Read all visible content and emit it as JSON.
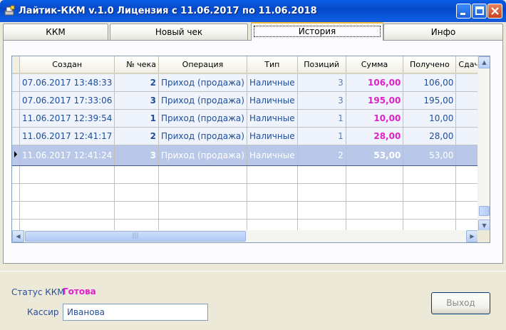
{
  "window": {
    "title": "Лайтик-ККМ v.1.0  Лицензия с 11.06.2017 по 11.06.2018"
  },
  "tabs": [
    {
      "label": "ККМ"
    },
    {
      "label": "Новый чек"
    },
    {
      "label": "История"
    },
    {
      "label": "Инфо"
    }
  ],
  "active_tab": "История",
  "table": {
    "columns": [
      "Создан",
      "№ чека",
      "Операция",
      "Тип",
      "Позиций",
      "Сумма",
      "Получено",
      "Сдача"
    ],
    "rows": [
      {
        "created": "07.06.2017 13:48:33",
        "number": "2",
        "operation": "Приход (продажа)",
        "type": "Наличные",
        "positions": "3",
        "sum": "106,00",
        "received": "106,00",
        "change": ""
      },
      {
        "created": "07.06.2017 17:33:06",
        "number": "3",
        "operation": "Приход (продажа)",
        "type": "Наличные",
        "positions": "3",
        "sum": "195,00",
        "received": "195,00",
        "change": ""
      },
      {
        "created": "11.06.2017 12:39:54",
        "number": "1",
        "operation": "Приход (продажа)",
        "type": "Наличные",
        "positions": "1",
        "sum": "10,00",
        "received": "10,00",
        "change": ""
      },
      {
        "created": "11.06.2017 12:41:17",
        "number": "2",
        "operation": "Приход (продажа)",
        "type": "Наличные",
        "positions": "1",
        "sum": "28,00",
        "received": "28,00",
        "change": ""
      },
      {
        "created": "11.06.2017 12:41:24",
        "number": "3",
        "operation": "Приход (продажа)",
        "type": "Наличные",
        "positions": "2",
        "sum": "53,00",
        "received": "53,00",
        "change": ""
      }
    ],
    "selected_row": 4
  },
  "footer": {
    "status_label": "Статус ККМ",
    "status_value": "Готова",
    "cashier_label": "Кассир",
    "cashier_value": "Иванова",
    "exit_label": "Выход"
  },
  "colors": {
    "accent": "#e020c8",
    "text_blue": "#1f4e9b",
    "title_bar": "#0548c8"
  },
  "icons": [
    "app-icon",
    "minimize-icon",
    "maximize-icon",
    "close-icon",
    "scroll-up-icon",
    "scroll-down-icon",
    "scroll-left-icon",
    "scroll-right-icon",
    "row-indicator-icon"
  ]
}
